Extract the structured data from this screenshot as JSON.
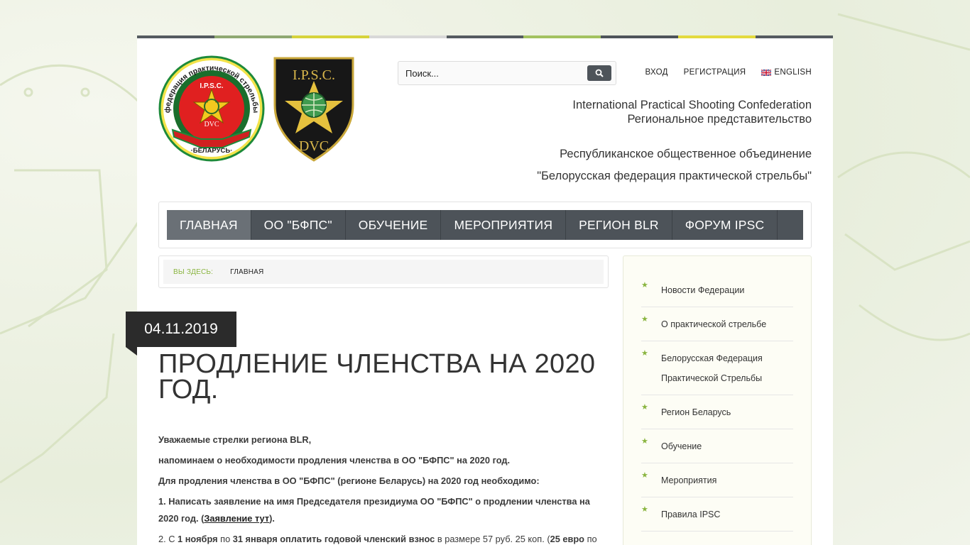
{
  "colors": {
    "stripe": [
      "#555b60",
      "#8fa872",
      "#d6d33c",
      "#d8d8d8",
      "#555b60",
      "#a3c260",
      "#4e545a",
      "#e3da3e",
      "#555b60"
    ],
    "nav_bg": "#4d5359",
    "nav_active": "#6a7076",
    "accent_green": "#8ab540",
    "date_badge": "#2b2b2b"
  },
  "logos": {
    "federation_text": "федерация практической стрельбы",
    "federation_country": "·БЕЛАРУСЬ·",
    "ipsc_text": "I.P.S.C.",
    "dvc_text": "DVC"
  },
  "search": {
    "placeholder": "Поиск..."
  },
  "toplinks": {
    "login": "ВХОД",
    "register": "РЕГИСТРАЦИЯ",
    "english": "ENGLISH"
  },
  "tagline": {
    "line1": "International Practical Shooting Confederation",
    "line2": "Региональное представительство",
    "line3": "Республиканское общественное объединение",
    "line4": "\"Белорусская федерация практической стрельбы\""
  },
  "nav": {
    "items": [
      {
        "label": "ГЛАВНАЯ"
      },
      {
        "label": "ОО \"БФПС\""
      },
      {
        "label": "ОБУЧЕНИЕ"
      },
      {
        "label": "МЕРОПРИЯТИЯ"
      },
      {
        "label": "РЕГИОН BLR"
      },
      {
        "label": "ФОРУМ IPSC"
      }
    ]
  },
  "breadcrumb": {
    "label": "ВЫ ЗДЕСЬ:",
    "current": "ГЛАВНАЯ"
  },
  "post": {
    "date": "04.11.2019",
    "title": "ПРОДЛЕНИЕ ЧЛЕНСТВА НА 2020 ГОД.",
    "p1": "Уважаемые стрелки региона BLR,",
    "p2": "напоминаем о необходимости продления членства в ОО \"БФПС\" на 2020 год.",
    "p3": "Для продления членства в ОО \"БФПС\" (регионе Беларусь) на 2020 год необходимо:",
    "p4_text": "1. Написать заявление на имя Председателя президиума ОО \"БФПС\" о продлении членства на 2020 год. (",
    "p4_link": "Заявление тут",
    "p4_end": ").",
    "p5_a": "2. С ",
    "p5_b": "1 ноября",
    "p5_c": " по ",
    "p5_d": "31 января",
    "p5_e": " оплатить годовой членский взнос",
    "p5_f": " в размере 57 руб. 25 коп. (",
    "p5_g": "25 евро",
    "p5_h": " по"
  },
  "sidebar": {
    "items": [
      {
        "label": "Новости Федерации"
      },
      {
        "label": "О практической стрельбе"
      },
      {
        "label": "Белорусская Федерация Практической Стрельбы"
      },
      {
        "label": "Регион Беларусь"
      },
      {
        "label": "Обучение"
      },
      {
        "label": "Мероприятия"
      },
      {
        "label": "Правила IPSC"
      }
    ]
  }
}
